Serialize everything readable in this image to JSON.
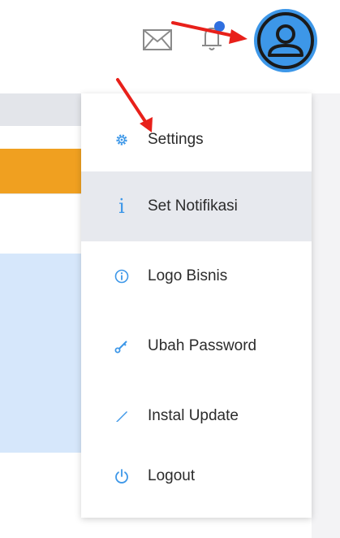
{
  "header": {
    "icons": [
      "mail-icon",
      "bell-icon",
      "user-avatar-icon"
    ],
    "notification_dot_color": "#2f6fe0",
    "avatar_color": "#3d97e8"
  },
  "menu": {
    "accent_color": "#3d97e8",
    "highlight_color": "#e7e9ee",
    "items": [
      {
        "label": "Settings",
        "icon": "gear-icon"
      },
      {
        "label": "Set Notifikasi",
        "icon": "info-icon"
      },
      {
        "label": "Logo Bisnis",
        "icon": "info-circle-icon"
      },
      {
        "label": "Ubah Password",
        "icon": "key-icon"
      },
      {
        "label": "Instal Update",
        "icon": "pencil-icon"
      },
      {
        "label": "Logout",
        "icon": "power-icon"
      }
    ],
    "highlighted_index": 1
  },
  "annotations": {
    "arrow_color": "#e8201a"
  }
}
